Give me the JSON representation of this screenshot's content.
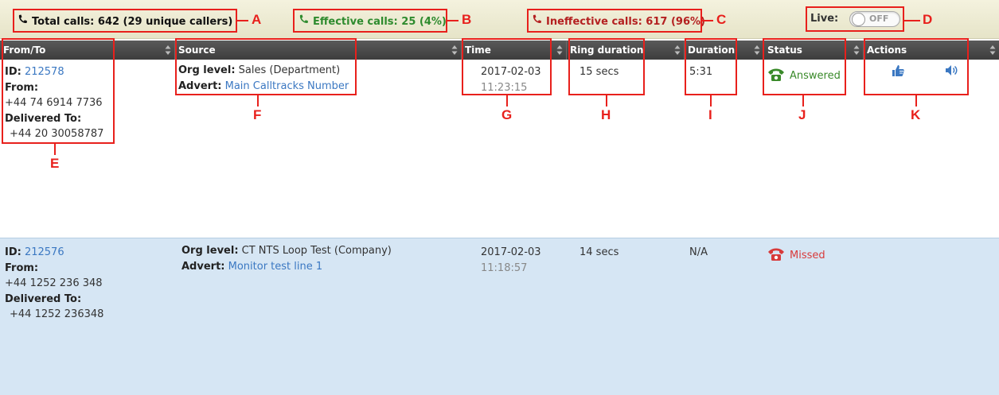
{
  "stats": {
    "total": "Total calls: 642 (29 unique callers)",
    "effective": "Effective calls: 25 (4%)",
    "ineffective": "Ineffective calls: 617 (96%)",
    "live_label": "Live:",
    "live_toggle": "OFF"
  },
  "columns": [
    "From/To",
    "Source",
    "Time",
    "Ring duration",
    "Duration",
    "Status",
    "Actions"
  ],
  "rows": [
    {
      "id_label": "ID:",
      "id": "212578",
      "from_label": "From:",
      "from": "+44 74 6914 7736",
      "delivered_label": "Delivered To:",
      "delivered": "+44 20 30058787",
      "org_label": "Org level:",
      "org": "Sales (Department)",
      "advert_label": "Advert:",
      "advert": "Main Calltracks Number",
      "date": "2017-02-03",
      "time": "11:23:15",
      "ring": "15 secs",
      "duration": "5:31",
      "status": "Answered"
    },
    {
      "id_label": "ID:",
      "id": "212576",
      "from_label": "From:",
      "from": "+44 1252 236 348",
      "delivered_label": "Delivered To:",
      "delivered": "+44 1252 236348",
      "org_label": "Org level:",
      "org": "CT NTS Loop Test (Company)",
      "advert_label": "Advert:",
      "advert": "Monitor test line 1",
      "date": "2017-02-03",
      "time": "11:18:57",
      "ring": "14 secs",
      "duration": "N/A",
      "status": "Missed"
    }
  ],
  "annotations": [
    "A",
    "B",
    "C",
    "D",
    "E",
    "F",
    "G",
    "H",
    "I",
    "J",
    "K"
  ],
  "colors": {
    "answered": "#3a8a2a",
    "missed": "#d83a3a",
    "link": "#3b78c2",
    "annotation": "#e8201c"
  }
}
